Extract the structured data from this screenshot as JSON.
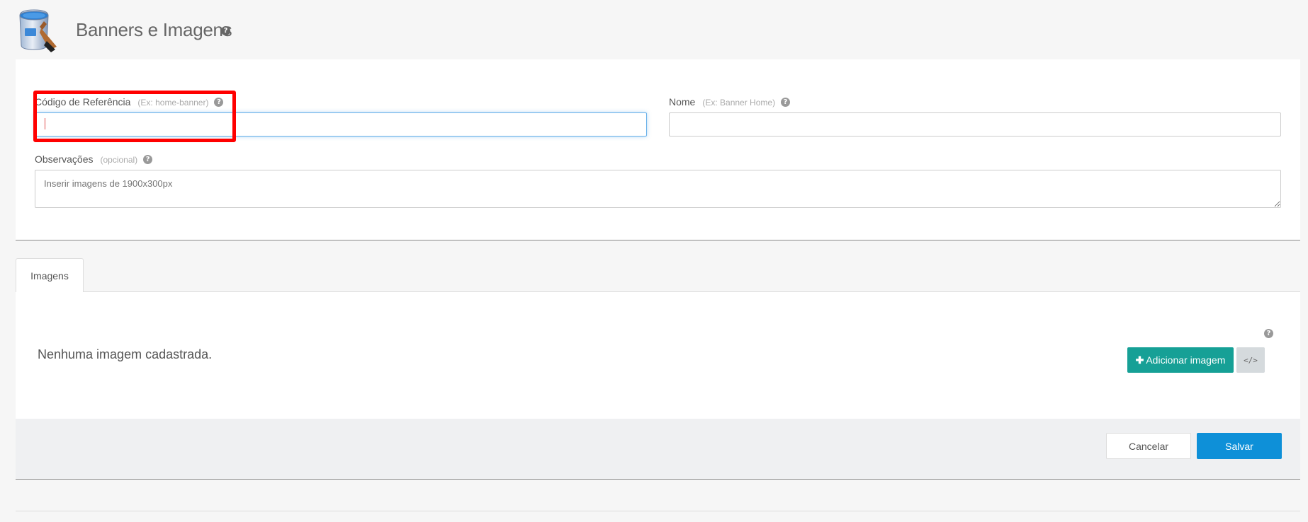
{
  "header": {
    "title": "Banners e Imagens",
    "help_icon": "question-circle-icon",
    "app_icon": "paint-bucket-icon"
  },
  "form": {
    "ref_code": {
      "label": "Código de Referência",
      "hint": "(Ex: home-banner)",
      "value": "",
      "placeholder": ""
    },
    "name": {
      "label": "Nome",
      "hint": "(Ex: Banner Home)",
      "value": "",
      "placeholder": ""
    },
    "notes": {
      "label": "Observações",
      "hint": "(opcional)",
      "value": "",
      "placeholder": "Inserir imagens de 1900x300px"
    }
  },
  "tabs": [
    {
      "label": "Imagens",
      "active": true
    }
  ],
  "images": {
    "empty_message": "Nenhuma imagem cadastrada.",
    "add_button_label": "Adicionar imagem",
    "add_button_icon": "plus-icon",
    "code_button_label": "</>",
    "code_button_icon": "code-icon"
  },
  "footer": {
    "cancel_label": "Cancelar",
    "save_label": "Salvar"
  },
  "colors": {
    "highlight": "#ff0000",
    "add_button": "#16a096",
    "save_button": "#0e90d8",
    "focus_border": "#66afe9"
  }
}
